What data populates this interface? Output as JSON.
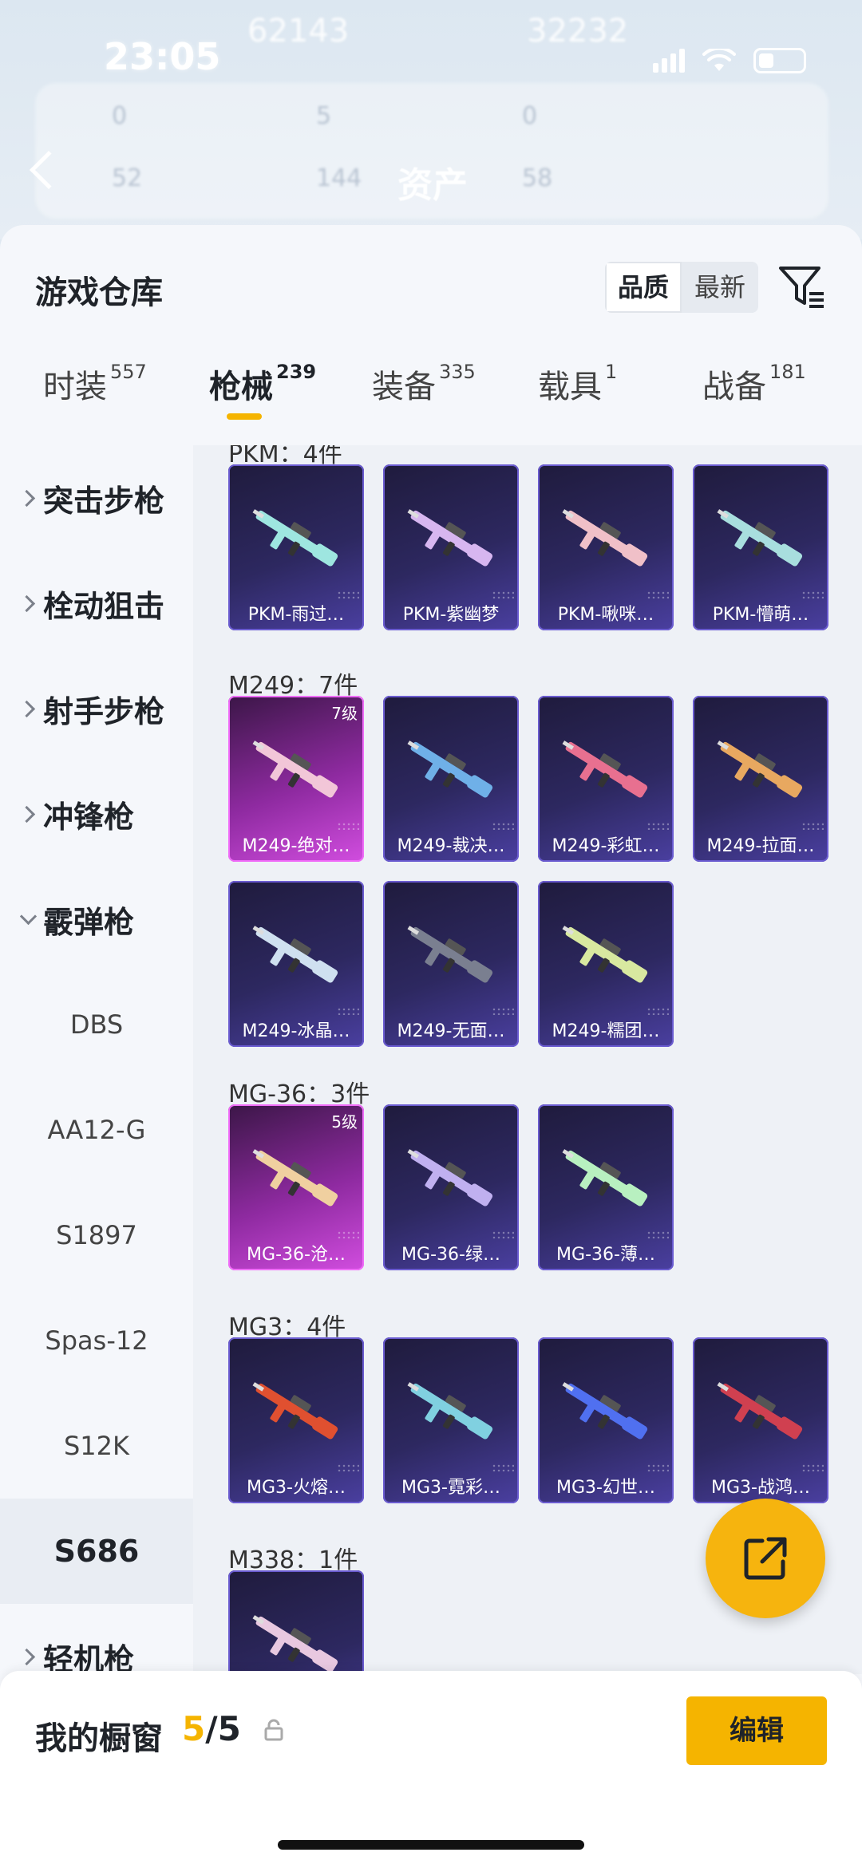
{
  "status_bar": {
    "time": "23:05"
  },
  "background_header": {
    "title": "资产",
    "ghost_numbers": [
      "62143",
      "32232",
      "0",
      "5",
      "0",
      "52",
      "144",
      "58"
    ]
  },
  "sheet": {
    "title": "游戏仓库",
    "sort": {
      "quality": "品质",
      "newest": "最新"
    },
    "tabs": [
      {
        "label": "时装",
        "count": "557"
      },
      {
        "label": "枪械",
        "count": "239"
      },
      {
        "label": "装备",
        "count": "335"
      },
      {
        "label": "载具",
        "count": "1"
      },
      {
        "label": "战备",
        "count": "181"
      }
    ]
  },
  "sidebar": {
    "categories": [
      {
        "label": "突击步枪"
      },
      {
        "label": "栓动狙击"
      },
      {
        "label": "射手步枪"
      },
      {
        "label": "冲锋枪"
      },
      {
        "label": "霰弹枪"
      }
    ],
    "subitems": [
      "DBS",
      "AA12-G",
      "S1897",
      "Spas-12",
      "S12K",
      "S686"
    ],
    "last_category": "轻机枪"
  },
  "groups": [
    {
      "title": "PKM：4件",
      "items": [
        {
          "name": "PKM-雨过…",
          "level": ""
        },
        {
          "name": "PKM-紫幽梦",
          "level": ""
        },
        {
          "name": "PKM-啾咪…",
          "level": ""
        },
        {
          "name": "PKM-懵萌…",
          "level": ""
        }
      ]
    },
    {
      "title": "M249：7件",
      "items": [
        {
          "name": "M249-绝对…",
          "level": "7级"
        },
        {
          "name": "M249-裁决…",
          "level": ""
        },
        {
          "name": "M249-彩虹…",
          "level": ""
        },
        {
          "name": "M249-拉面…",
          "level": ""
        },
        {
          "name": "M249-冰晶…",
          "level": ""
        },
        {
          "name": "M249-无面…",
          "level": ""
        },
        {
          "name": "M249-糯团…",
          "level": ""
        }
      ]
    },
    {
      "title": "MG-36：3件",
      "items": [
        {
          "name": "MG-36-沧…",
          "level": "5级"
        },
        {
          "name": "MG-36-绿…",
          "level": ""
        },
        {
          "name": "MG-36-薄…",
          "level": ""
        }
      ]
    },
    {
      "title": "MG3：4件",
      "items": [
        {
          "name": "MG3-火熔…",
          "level": ""
        },
        {
          "name": "MG3-霓彩…",
          "level": ""
        },
        {
          "name": "MG3-幻世…",
          "level": ""
        },
        {
          "name": "MG3-战鸿…",
          "level": ""
        }
      ]
    },
    {
      "title": "M338：1件",
      "items": [
        {
          "name": "",
          "level": ""
        }
      ]
    }
  ],
  "bottom": {
    "label": "我的橱窗",
    "current": "5",
    "total": "/5",
    "edit": "编辑"
  },
  "colors": {
    "accent": "#f5b400",
    "card_purple": "#2d2860",
    "card_gold": "#8e2aa0"
  }
}
